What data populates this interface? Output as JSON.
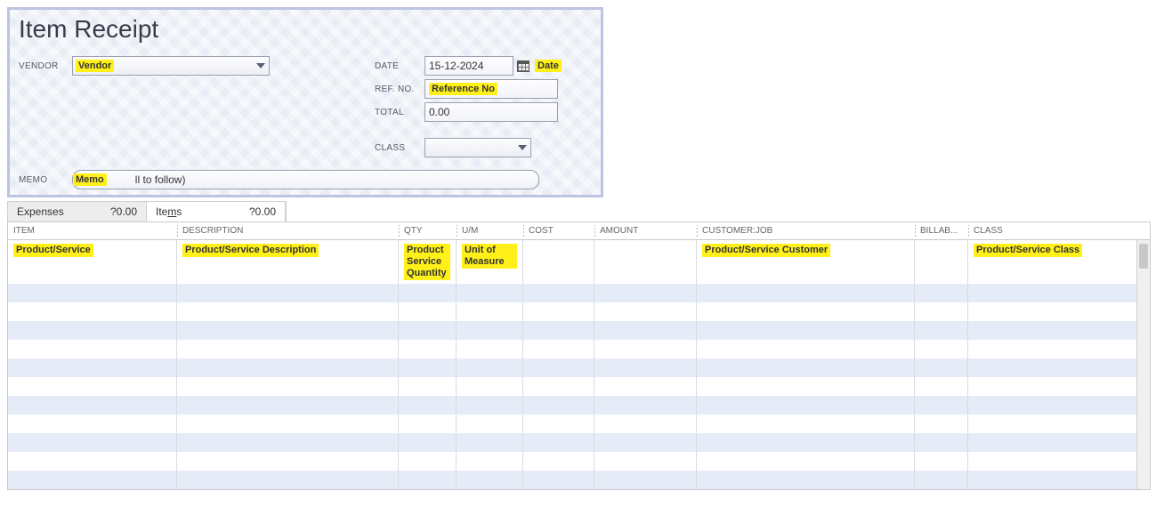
{
  "title": "Item Receipt",
  "labels": {
    "vendor": "VENDOR",
    "date": "DATE",
    "ref_no": "REF. NO.",
    "total": "TOTAL",
    "class": "CLASS",
    "memo": "MEMO"
  },
  "form": {
    "vendor_value": "Vendor",
    "date_value": "15-12-2024",
    "date_annot": "Date",
    "ref_no_value": "Reference No",
    "total_value": "0.00",
    "memo_value": "Memo",
    "memo_rest": "ll to follow)"
  },
  "tabs": {
    "expenses": {
      "label": "Expenses",
      "amount": "?0.00"
    },
    "items": {
      "label_pre": "Ite",
      "label_u": "m",
      "label_post": "s",
      "amount": "?0.00"
    }
  },
  "grid": {
    "headers": {
      "item": "ITEM",
      "description": "DESCRIPTION",
      "qty": "QTY",
      "um": "U/M",
      "cost": "COST",
      "amount": "AMOUNT",
      "customer": "CUSTOMER:JOB",
      "billab": "BILLAB...",
      "class": "CLASS"
    },
    "row1": {
      "item": "Product/Service",
      "description": "Product/Service Description",
      "qty": "Product Service Quantity",
      "um": "Unit of Measure",
      "customer": "Product/Service Customer",
      "class": "Product/Service Class"
    }
  }
}
